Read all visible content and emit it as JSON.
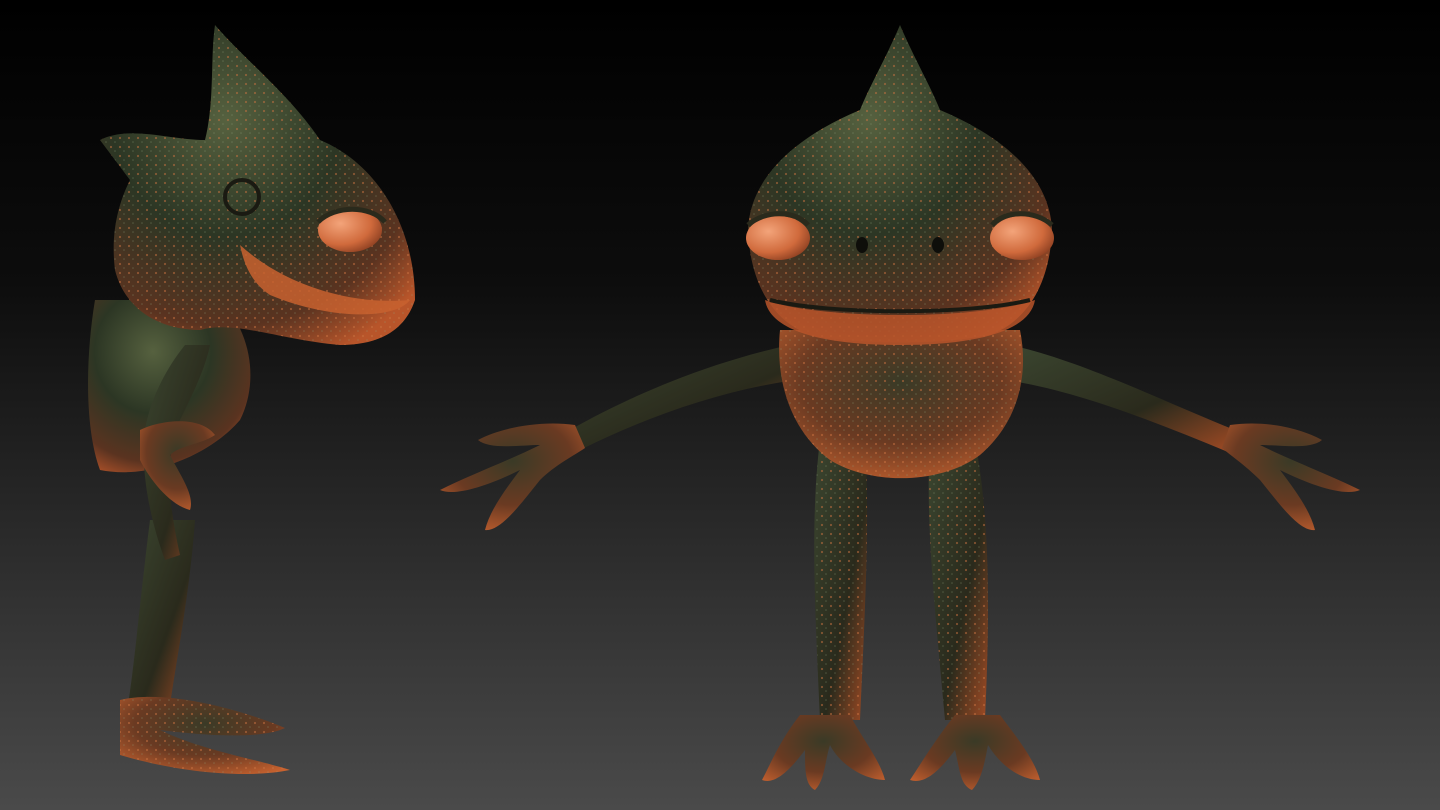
{
  "scene": {
    "background_top": "#000000",
    "background_bottom": "#4a4a4a",
    "skin_dark": "#1f2a1c",
    "skin_mid": "#3d4a2f",
    "skin_warm": "#b8552a",
    "skin_highlight": "#e07a45",
    "eye_color": "#e8875a",
    "figures": [
      {
        "view": "side",
        "icon": "creature-side-view"
      },
      {
        "view": "front",
        "icon": "creature-front-view"
      }
    ]
  }
}
